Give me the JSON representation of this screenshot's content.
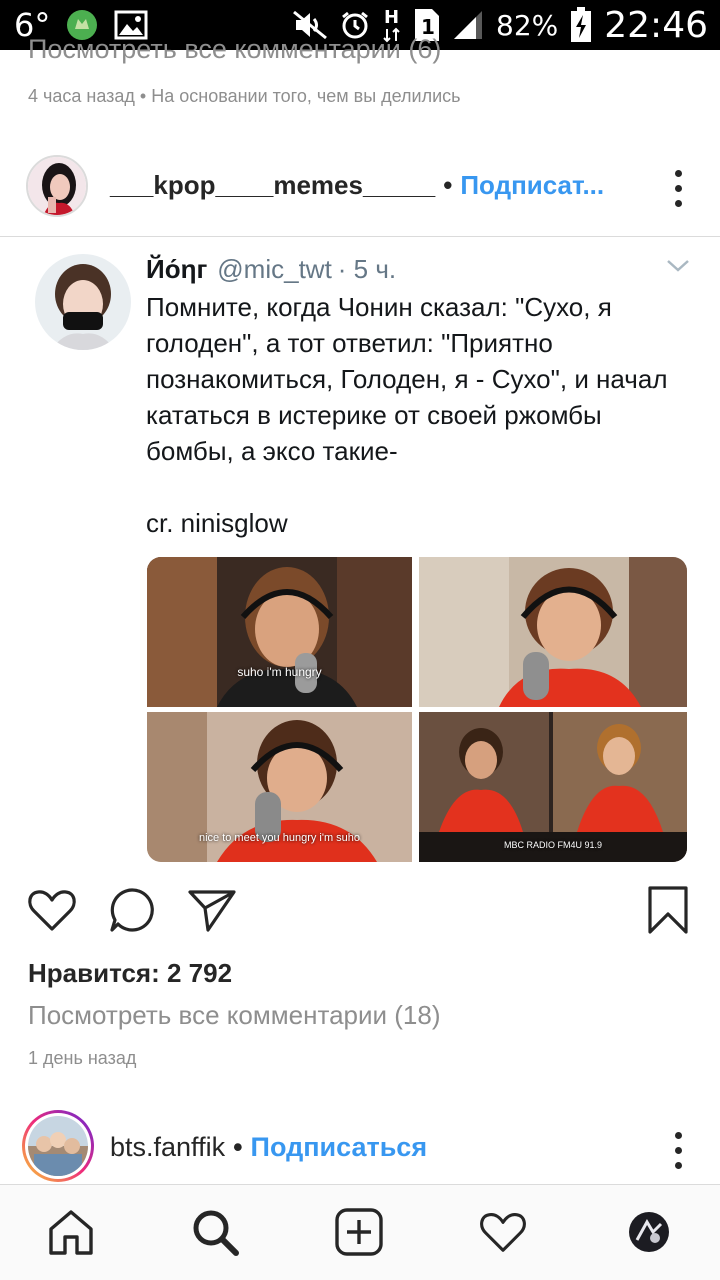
{
  "status_bar": {
    "temperature": "6°",
    "battery_percent": "82%",
    "clock": "22:46",
    "sim_slot": "1"
  },
  "previous_post": {
    "view_comments": "Посмотреть все комментарии (6)",
    "meta": "4 часа назад • На основании того, чем вы делились"
  },
  "post": {
    "username": "___kpop____memes_____",
    "separator": "•",
    "follow_label": "Подписат...",
    "likes": "Нравится: 2 792",
    "view_comments": "Посмотреть все комментарии (18)",
    "time": "1 день назад"
  },
  "tweet": {
    "name": "Йо́ηг",
    "handle": "@mic_twt",
    "time": "· 5 ч.",
    "text": "Помните, когда Чонин сказал: \"Сухо, я голоден\", а тот ответил: \"Приятно познакомиться, Голоден, я - Сухо\", и начал кататься в истерике от своей ржомбы бомбы, а эксо такие-\n\ncr. ninisglow",
    "caption_1": "suho i'm hungry",
    "caption_2": "nice to meet you hungry i'm suho",
    "caption_3": "MBC RADIO FM4U 91.9"
  },
  "next_post": {
    "username": "bts.fanffik",
    "separator": "•",
    "follow_label": "Подписаться"
  },
  "colors": {
    "accent": "#3897f0",
    "muted": "#8e8e8e",
    "text": "#262626"
  }
}
